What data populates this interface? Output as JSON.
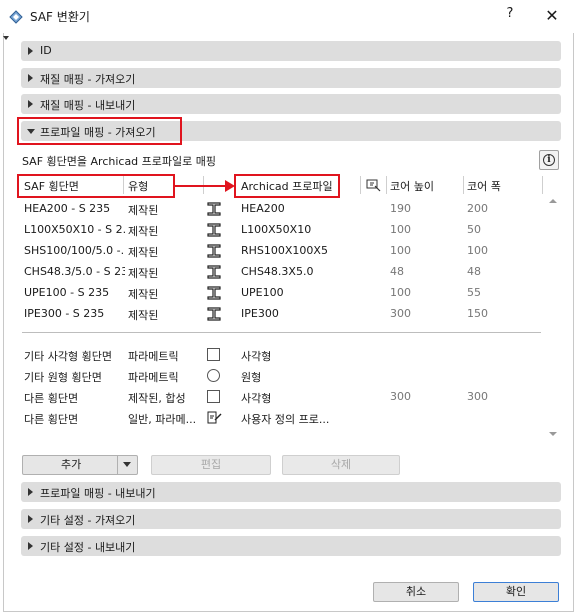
{
  "window": {
    "title": "SAF 변환기",
    "help_label": "?",
    "close_label": "✕"
  },
  "sections": {
    "id": "ID",
    "material_import": "재질 매핑 - 가져오기",
    "material_export": "재질 매핑 - 내보내기",
    "profile_import": "프로파일 매핑 - 가져오기",
    "profile_export": "프로파일 매핑 - 내보내기",
    "other_import": "기타 설정 - 가져오기",
    "other_export": "기타 설정 - 내보내기"
  },
  "profile_import": {
    "subtitle": "SAF 횡단면을 Archicad 프로파일로 매핑",
    "info_label": "i",
    "columns": {
      "saf_section": "SAF 횡단면",
      "type": "유형",
      "archicad_profile": "Archicad 프로파일",
      "core_height": "코어 높이",
      "core_width": "코어 폭"
    },
    "rows": [
      {
        "saf": "HEA200 - S 235",
        "type": "제작된",
        "icon": "i-beam-icon",
        "profile": "HEA200",
        "height": "190",
        "width": "200"
      },
      {
        "saf": "L100X50X10 - S 2...",
        "type": "제작된",
        "icon": "i-beam-icon",
        "profile": "L100X50X10",
        "height": "100",
        "width": "50"
      },
      {
        "saf": "SHS100/100/5.0 -...",
        "type": "제작된",
        "icon": "i-beam-icon",
        "profile": "RHS100X100X5",
        "height": "100",
        "width": "100"
      },
      {
        "saf": "CHS48.3/5.0 - S 235",
        "type": "제작된",
        "icon": "i-beam-icon",
        "profile": "CHS48.3X5.0",
        "height": "48",
        "width": "48"
      },
      {
        "saf": "UPE100 - S 235",
        "type": "제작된",
        "icon": "i-beam-icon",
        "profile": "UPE100",
        "height": "100",
        "width": "55"
      },
      {
        "saf": "IPE300 - S 235",
        "type": "제작된",
        "icon": "i-beam-icon",
        "profile": "IPE300",
        "height": "300",
        "width": "150"
      }
    ],
    "other_rows": [
      {
        "saf": "기타 사각형 횡단면",
        "type": "파라메트릭",
        "icon": "square-icon",
        "profile": "사각형",
        "height": "",
        "width": ""
      },
      {
        "saf": "기타 원형 횡단면",
        "type": "파라메트릭",
        "icon": "circle-icon",
        "profile": "원형",
        "height": "",
        "width": ""
      },
      {
        "saf": "다른 횡단면",
        "type": "제작된, 합성",
        "icon": "square-icon",
        "profile": "사각형",
        "height": "300",
        "width": "300"
      },
      {
        "saf": "다른 횡단면",
        "type": "일반, 파라메...",
        "icon": "custom-profile-icon",
        "profile": "사용자 정의 프로...",
        "height": "",
        "width": ""
      }
    ],
    "buttons": {
      "add": "추가",
      "edit": "편집",
      "delete": "삭제"
    }
  },
  "footer": {
    "cancel": "취소",
    "ok": "확인"
  },
  "colors": {
    "highlight_red": "#e0141e",
    "section_bg": "#dddddd",
    "muted_text": "#777777"
  }
}
